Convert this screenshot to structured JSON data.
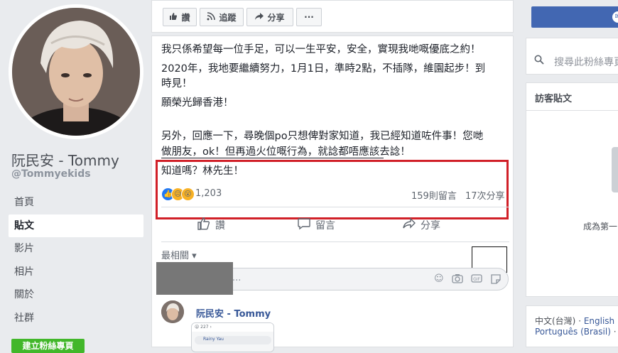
{
  "page": {
    "name": "阮民安 - Tommy",
    "handle": "@Tommyekids",
    "nav": [
      "首頁",
      "貼文",
      "影片",
      "相片",
      "關於",
      "社群"
    ],
    "cta_label": "建立粉絲專頁"
  },
  "action_bar": {
    "like": "讚",
    "follow": "追蹤",
    "share": "分享",
    "more": "···"
  },
  "post": {
    "lines": [
      "我只係希望每一位手足，可以一生平安，安全，實現我哋嘅優底之約！",
      "2020年，我地要繼續努力，1月1日，準時2點，不插隊，維園起步！到",
      "時見！",
      "願榮光歸香港！",
      "另外，回應一下，尋晚個po只想俾對家知道，我已經知道咗件事！您哋",
      "做朋友，ok！但再過火位嘅行為，就諗都唔應該去諗！",
      "知道嗎？林先生！"
    ],
    "reaction_count": "1,203",
    "comment_count": "159則留言",
    "share_count": "17次分享",
    "actions": {
      "like": "讚",
      "comment": "留言",
      "share": "分享"
    },
    "sort_label": "最相關 ▾",
    "comment_placeholder": "...",
    "reply_author": "阮民安 - Tommy",
    "reply_shot_text": "Rainy Yau"
  },
  "right": {
    "search_placeholder": "搜尋此粉絲專頁",
    "visitor_title": "訪客貼文",
    "visitor_empty": "成為第一",
    "languages": {
      "l1": "中文(台灣)",
      "dot": " · ",
      "l2": "English",
      "l3": "Português (Brasil)",
      "dot2": " · "
    }
  },
  "colors": {
    "accent": "#4267b2",
    "highlight_border": "#d12028",
    "cta": "#42b72a"
  }
}
